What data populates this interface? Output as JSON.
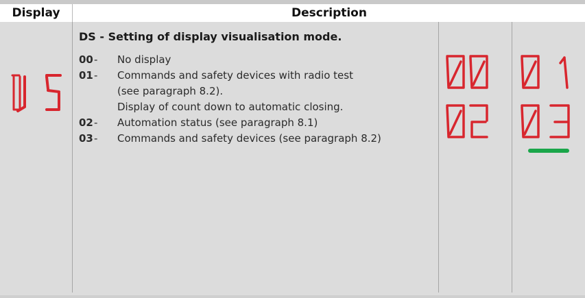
{
  "header": {
    "display": "Display",
    "description": "Description"
  },
  "param_code": "DS",
  "title": "DS - Setting of display visualisation mode.",
  "options": [
    {
      "code": "00",
      "dash": "-",
      "lines": [
        "No display"
      ]
    },
    {
      "code": "01",
      "dash": "-",
      "lines": [
        "Commands and safety devices with radio test",
        "(see paragraph 8.2).",
        "Display of count down to automatic closing."
      ]
    },
    {
      "code": "02",
      "dash": "-",
      "lines": [
        "Automation status (see paragraph 8.1)"
      ]
    },
    {
      "code": "03",
      "dash": "-",
      "lines": [
        "Commands and safety devices (see paragraph 8.2)"
      ]
    }
  ],
  "segment_displays": [
    "00",
    "01",
    "02",
    "03"
  ],
  "selected_display": "03",
  "colors": {
    "segment_red": "#d8262e",
    "selected_green": "#1aa64a"
  }
}
